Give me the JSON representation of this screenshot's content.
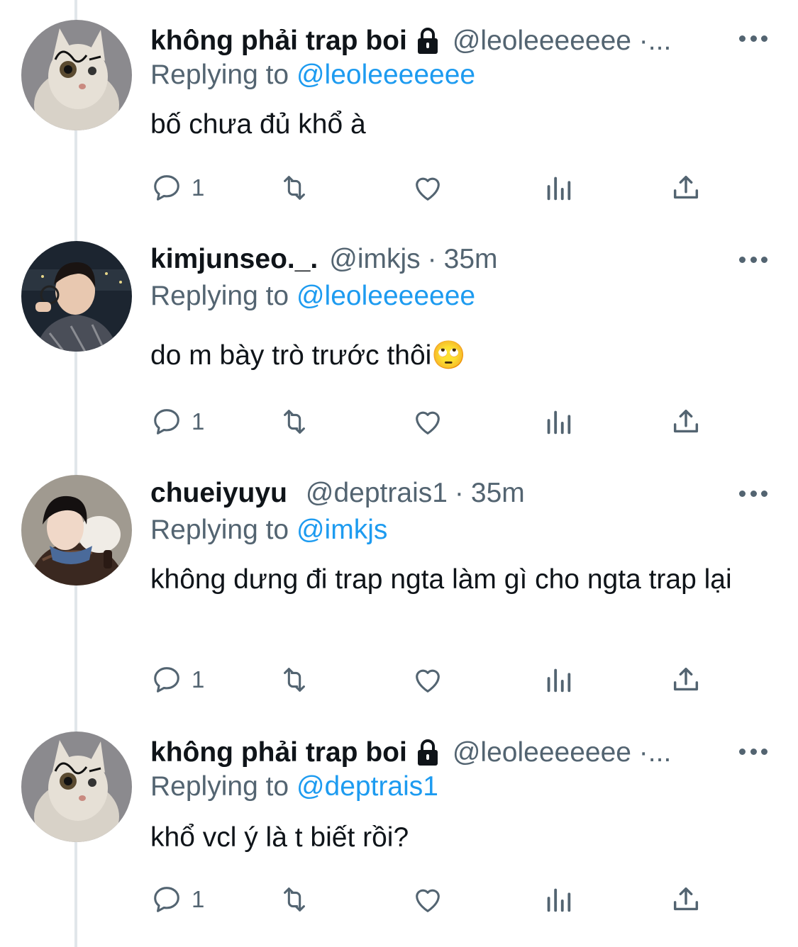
{
  "tweets": [
    {
      "display_name": "không phải trap boi",
      "handle": "@leoleeeeeee ·...",
      "time": "",
      "replying_prefix": "Replying to ",
      "replying_to": "@leoleeeeeee",
      "text": "bố chưa đủ khổ à",
      "reply_count": "1",
      "locked": true,
      "avatar": "cat-avatar"
    },
    {
      "display_name": "kimjunseo._.",
      "handle": "@imkjs",
      "time": "35m",
      "replying_prefix": "Replying to ",
      "replying_to": "@leoleeeeeee",
      "text": "do m bày trò trước thôi🙄",
      "reply_count": "1",
      "locked": false,
      "avatar": "man-with-glasses-avatar"
    },
    {
      "display_name": "chueiyuyu",
      "handle": "@deptrais1",
      "time": "35m",
      "replying_prefix": "Replying to ",
      "replying_to": "@imkjs",
      "text": "không dưng đi trap ngta làm gì cho ngta trap lại",
      "reply_count": "1",
      "locked": false,
      "avatar": "person-with-cat-avatar"
    },
    {
      "display_name": "không phải trap boi",
      "handle": "@leoleeeeeee ·...",
      "time": "",
      "replying_prefix": "Replying to ",
      "replying_to": "@deptrais1",
      "text": "khổ vcl ý là t biết rồi?",
      "reply_count": "1",
      "locked": true,
      "avatar": "cat-avatar"
    }
  ],
  "colors": {
    "link": "#1d9bf0",
    "secondary_text": "#536471",
    "thread_line": "#e1e6ea"
  }
}
